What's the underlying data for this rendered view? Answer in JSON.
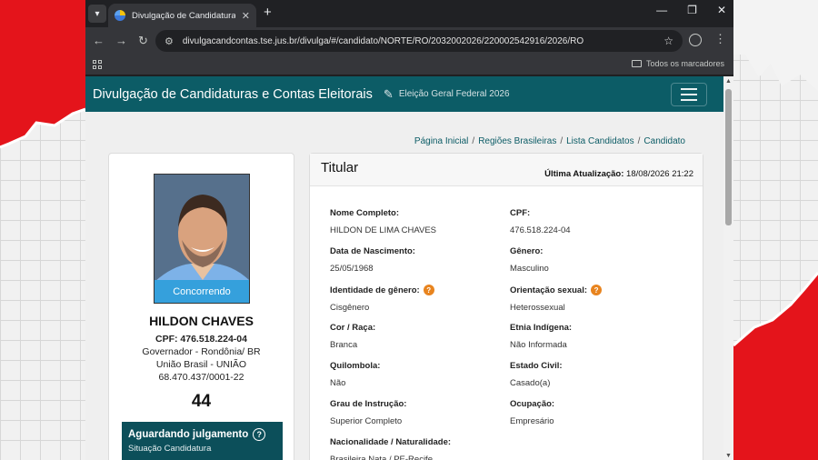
{
  "browser": {
    "tab_title": "Divulgação de Candidaturas e Contas Eleitorais",
    "url": "divulgacandcontas.tse.jus.br/divulga/#/candidato/NORTE/RO/2032002026/220002542916/2026/RO",
    "bookmarks_label": "Todos os marcadores"
  },
  "header": {
    "title": "Divulgação de Candidaturas e Contas Eleitorais",
    "election": "Eleição Geral Federal 2026"
  },
  "breadcrumb": [
    "Página Inicial",
    "Regiões Brasileiras",
    "Lista Candidatos",
    "Candidato"
  ],
  "candidate": {
    "status": "Concorrendo",
    "name": "HILDON CHAVES",
    "cpf_line": "CPF: 476.518.224-04",
    "role": "Governador - Rondônia/ BR",
    "party": "União Brasil - UNIÃO",
    "cnpj": "68.470.437/0001-22",
    "number": "44",
    "judgement_title": "Aguardando julgamento",
    "judgement_sub": "Situação Candidatura"
  },
  "details": {
    "title": "Titular",
    "last_update_label": "Última Atualização:",
    "last_update_value": "18/08/2026 21:22",
    "fields": [
      {
        "label": "Nome Completo:",
        "value": "HILDON DE LIMA CHAVES"
      },
      {
        "label": "CPF:",
        "value": "476.518.224-04"
      },
      {
        "label": "Data de Nascimento:",
        "value": "25/05/1968"
      },
      {
        "label": "Gênero:",
        "value": "Masculino"
      },
      {
        "label": "Identidade de gênero:",
        "value": "Cisgênero",
        "help": "?"
      },
      {
        "label": "Orientação sexual:",
        "value": "Heterossexual",
        "help": "?"
      },
      {
        "label": "Cor / Raça:",
        "value": "Branca"
      },
      {
        "label": "Etnia Indígena:",
        "value": "Não Informada"
      },
      {
        "label": "Quilombola:",
        "value": "Não"
      },
      {
        "label": "Estado Civil:",
        "value": "Casado(a)"
      },
      {
        "label": "Grau de Instrução:",
        "value": "Superior Completo"
      },
      {
        "label": "Ocupação:",
        "value": "Empresário"
      },
      {
        "label": "Nacionalidade / Naturalidade:",
        "value": "Brasileira Nata / PE-Recife"
      }
    ]
  },
  "colors": {
    "header": "#0c5c66",
    "status_strip": "#35a0dc",
    "judgement_box": "#0c4f5a",
    "info_badge": "#e8841f"
  }
}
